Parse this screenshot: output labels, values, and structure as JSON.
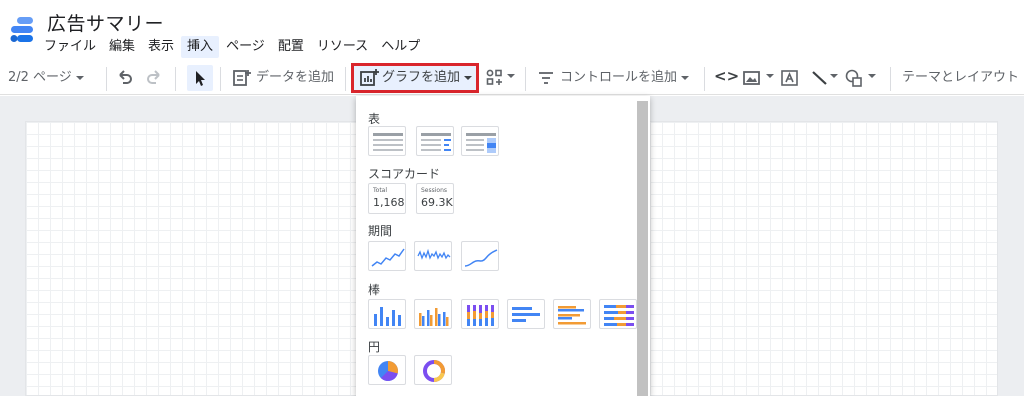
{
  "app": {
    "title": "広告サマリー"
  },
  "menu": [
    "ファイル",
    "編集",
    "表示",
    "挿入",
    "ページ",
    "配置",
    "リソース",
    "ヘルプ"
  ],
  "toolbar": {
    "page_indicator": "2/2 ページ",
    "add_data": "データを追加",
    "add_chart": "グラフを追加",
    "add_control": "コントロールを追加",
    "theme_layout": "テーマとレイアウト"
  },
  "chart_menu": {
    "sections": {
      "table": "表",
      "scorecard": "スコアカード",
      "timeseries": "期間",
      "bar": "棒",
      "pie": "円"
    },
    "scorecards": [
      {
        "label": "Total",
        "value": "1,168"
      },
      {
        "label": "Sessions",
        "value": "69.3K"
      }
    ]
  },
  "colors": {
    "accent": "#1a73e8",
    "highlight": "#d9252c",
    "orange": "#f29b34",
    "purple": "#7b4ef0"
  }
}
